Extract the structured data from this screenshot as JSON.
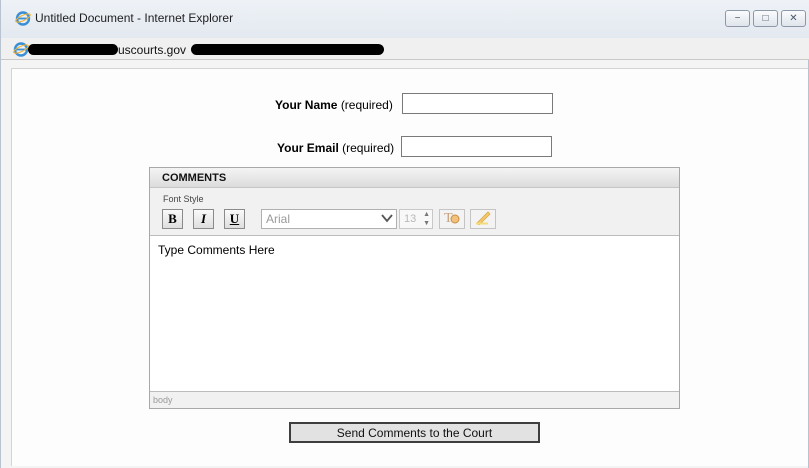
{
  "window": {
    "title": "Untitled Document - Internet Explorer",
    "controls": {
      "minimize": "−",
      "maximize": "□",
      "close": "✕"
    }
  },
  "address": {
    "visible_text": "uscourts.gov"
  },
  "form": {
    "name_label": "Your Name",
    "name_required": "(required)",
    "name_value": "",
    "email_label": "Your Email",
    "email_required": "(required)",
    "email_value": ""
  },
  "editor": {
    "header": "COMMENTS",
    "font_style_label": "Font Style",
    "bold_label": "B",
    "italic_label": "I",
    "underline_label": "U",
    "font_family_value": "Arial",
    "font_size_value": "13",
    "body_text": "Type Comments Here",
    "status_text": "body"
  },
  "submit": {
    "label": "Send Comments to the Court"
  },
  "colors": {
    "titlebar": "#e3e9f0",
    "ie_icon": "#3a8fd6",
    "redaction": "#000000"
  },
  "icons": [
    "ie-logo-icon",
    "page-icon",
    "text-color-icon",
    "highlight-icon"
  ]
}
